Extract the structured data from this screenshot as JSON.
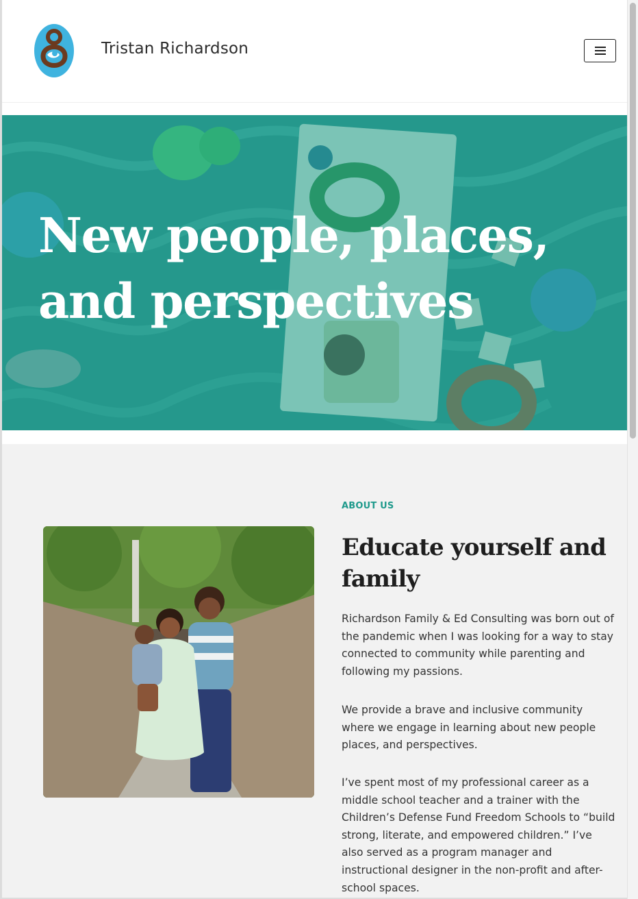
{
  "header": {
    "site_title": "Tristan Richardson",
    "logo_icon": "mother-child-logo-icon",
    "menu_icon": "hamburger-menu-icon"
  },
  "hero": {
    "heading": "New people, places, and perspectives"
  },
  "about": {
    "eyebrow": "ABOUT US",
    "heading": "Educate yourself and family",
    "paragraphs": [
      "Richardson Family & Ed Consulting was born out of the pandemic when I was looking for a way to stay connected to community while parenting and following my passions.",
      "We provide a brave and inclusive community where we engage in learning about new people places, and perspectives.",
      "I’ve spent most of my professional career as a middle school teacher and a trainer with the Children’s Defense Fund Freedom Schools to “build strong, literate, and empowered children.” I’ve also served as a program manager and instructional designer in the non-profit and after-school spaces."
    ]
  },
  "colors": {
    "accent": "#1f9a8c",
    "logo_blue": "#3fb3df",
    "logo_brown": "#6b3a1f",
    "text": "#333333"
  }
}
